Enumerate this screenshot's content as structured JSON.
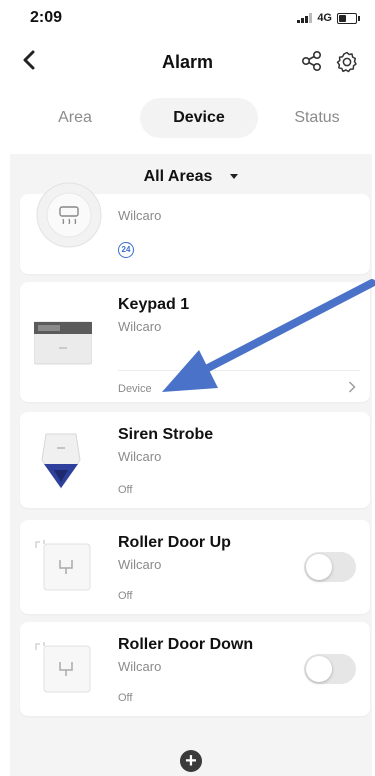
{
  "status_bar": {
    "time": "2:09",
    "network": "4G",
    "battery_level": 0.4
  },
  "nav": {
    "back_icon": "chevron-left-icon",
    "title": "Alarm",
    "share_icon": "share-icon",
    "settings_icon": "gear-icon"
  },
  "tabs": [
    {
      "label": "Area",
      "active": false
    },
    {
      "label": "Device",
      "active": true
    },
    {
      "label": "Status",
      "active": false
    }
  ],
  "filter": {
    "label": "All Areas",
    "icon": "caret-down-icon"
  },
  "devices": [
    {
      "name": "",
      "brand": "Wilcaro",
      "badge": "24",
      "icon": "heater-icon"
    },
    {
      "name": "Keypad 1",
      "brand": "Wilcaro",
      "footer_label": "Device",
      "footer_icon": "chevron-right-icon",
      "icon": "keypad-icon"
    },
    {
      "name": "Siren Strobe",
      "brand": "Wilcaro",
      "state": "Off",
      "icon": "siren-icon"
    },
    {
      "name": "Roller Door Up",
      "brand": "Wilcaro",
      "state": "Off",
      "icon": "switch-module-icon",
      "toggle_on": false
    },
    {
      "name": "Roller Door Down",
      "brand": "Wilcaro",
      "state": "Off",
      "icon": "switch-module-icon",
      "toggle_on": false
    }
  ],
  "add_button": {
    "label": "+",
    "icon": "plus-icon"
  },
  "colors": {
    "accent_blue": "#3b6fd0",
    "arrow_blue": "#4a72c9",
    "page_bg": "#f4f4f4"
  }
}
